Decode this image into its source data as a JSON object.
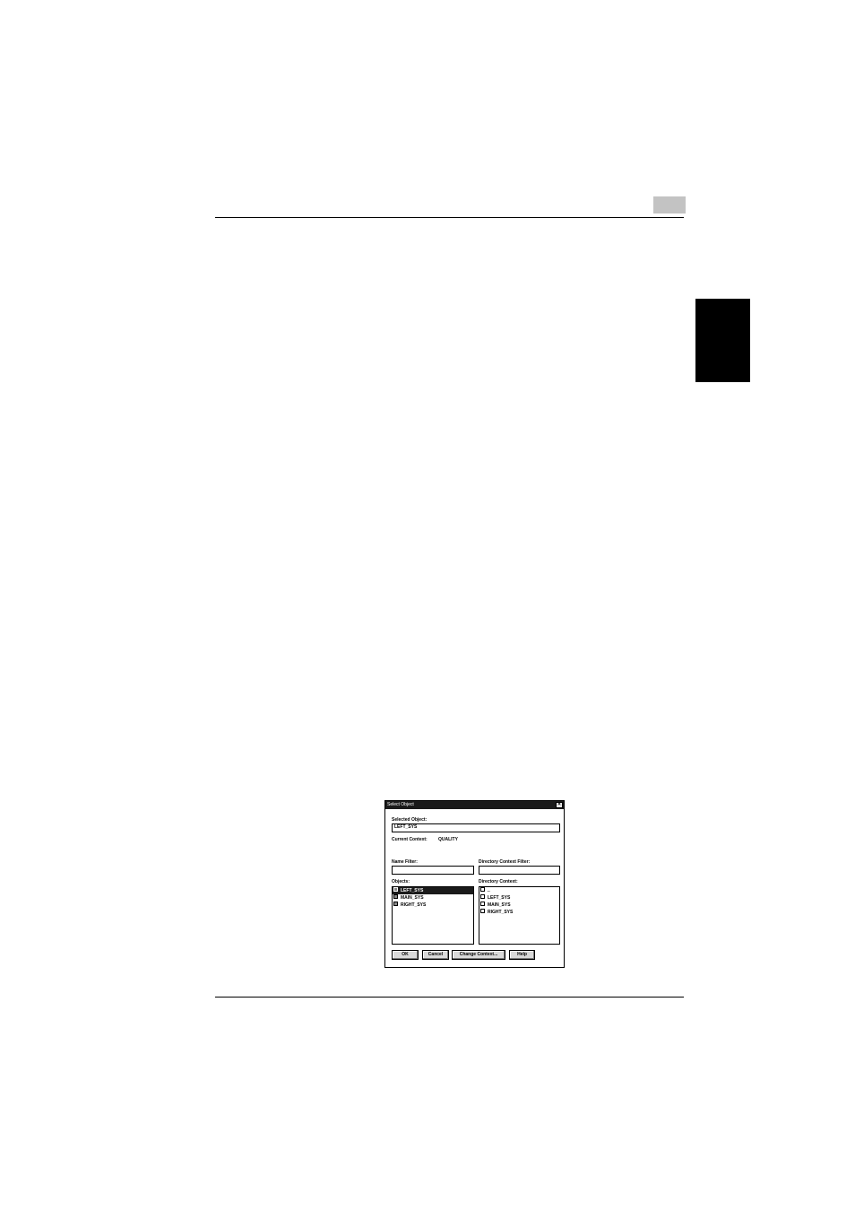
{
  "dialog": {
    "title": "Select Object",
    "close_glyph": "×",
    "selected_object_label": "Selected Object:",
    "selected_object_value": "LEFT_SYS",
    "current_context_label": "Current Context:",
    "current_context_value": "QUALITY",
    "name_filter_label": "Name Filter:",
    "name_filter_value": "",
    "dir_context_filter_label": "Directory Context Filter:",
    "dir_context_filter_value": "",
    "objects_label": "Objects:",
    "objects": [
      "LEFT_SYS",
      "MAIN_SYS",
      "RIGHT_SYS"
    ],
    "dir_context_label": "Directory Context:",
    "dir_context_items": [
      "..",
      "LEFT_SYS",
      "MAIN_SYS",
      "RIGHT_SYS"
    ],
    "buttons": {
      "ok": "OK",
      "cancel": "Cancel",
      "change_context": "Change Context...",
      "help": "Help"
    }
  }
}
